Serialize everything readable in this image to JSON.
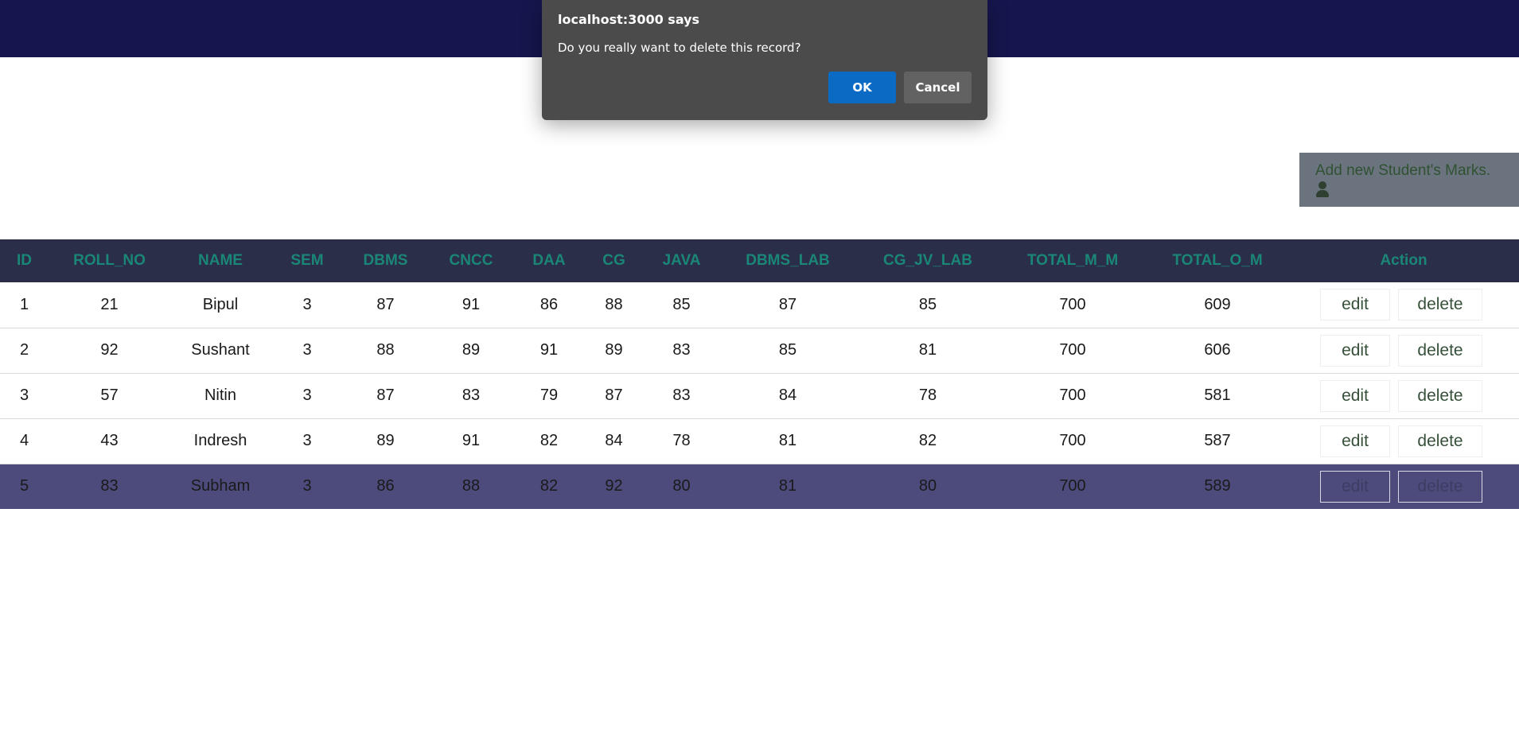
{
  "dialog": {
    "title": "localhost:3000 says",
    "message": "Do you really want to delete this record?",
    "ok_label": "OK",
    "cancel_label": "Cancel"
  },
  "add_button": {
    "label": "Add new Student's Marks.",
    "icon": "user-icon"
  },
  "table": {
    "headers": [
      "ID",
      "ROLL_NO",
      "NAME",
      "SEM",
      "DBMS",
      "CNCC",
      "DAA",
      "CG",
      "JAVA",
      "DBMS_LAB",
      "CG_JV_LAB",
      "TOTAL_M_M",
      "TOTAL_O_M",
      "Action"
    ],
    "rows": [
      {
        "id": "1",
        "roll_no": "21",
        "name": "Bipul",
        "sem": "3",
        "dbms": "87",
        "cncc": "91",
        "daa": "86",
        "cg": "88",
        "java": "85",
        "dbms_lab": "87",
        "cg_jv_lab": "85",
        "total_m_m": "700",
        "total_o_m": "609",
        "edit_label": "edit",
        "delete_label": "delete"
      },
      {
        "id": "2",
        "roll_no": "92",
        "name": "Sushant",
        "sem": "3",
        "dbms": "88",
        "cncc": "89",
        "daa": "91",
        "cg": "89",
        "java": "83",
        "dbms_lab": "85",
        "cg_jv_lab": "81",
        "total_m_m": "700",
        "total_o_m": "606",
        "edit_label": "edit",
        "delete_label": "delete"
      },
      {
        "id": "3",
        "roll_no": "57",
        "name": "Nitin",
        "sem": "3",
        "dbms": "87",
        "cncc": "83",
        "daa": "79",
        "cg": "87",
        "java": "83",
        "dbms_lab": "84",
        "cg_jv_lab": "78",
        "total_m_m": "700",
        "total_o_m": "581",
        "edit_label": "edit",
        "delete_label": "delete"
      },
      {
        "id": "4",
        "roll_no": "43",
        "name": "Indresh",
        "sem": "3",
        "dbms": "89",
        "cncc": "91",
        "daa": "82",
        "cg": "84",
        "java": "78",
        "dbms_lab": "81",
        "cg_jv_lab": "82",
        "total_m_m": "700",
        "total_o_m": "587",
        "edit_label": "edit",
        "delete_label": "delete"
      },
      {
        "id": "5",
        "roll_no": "83",
        "name": "Subham",
        "sem": "3",
        "dbms": "86",
        "cncc": "88",
        "daa": "82",
        "cg": "92",
        "java": "80",
        "dbms_lab": "81",
        "cg_jv_lab": "80",
        "total_m_m": "700",
        "total_o_m": "589",
        "edit_label": "edit",
        "delete_label": "delete"
      }
    ]
  },
  "colors": {
    "topbar": "#16164e",
    "header_bg": "#2b2e48",
    "header_text": "#1a8677",
    "selected_row": "#4d4b7c",
    "dialog_bg": "#4b4b4b",
    "ok_button": "#0b6bc4"
  }
}
